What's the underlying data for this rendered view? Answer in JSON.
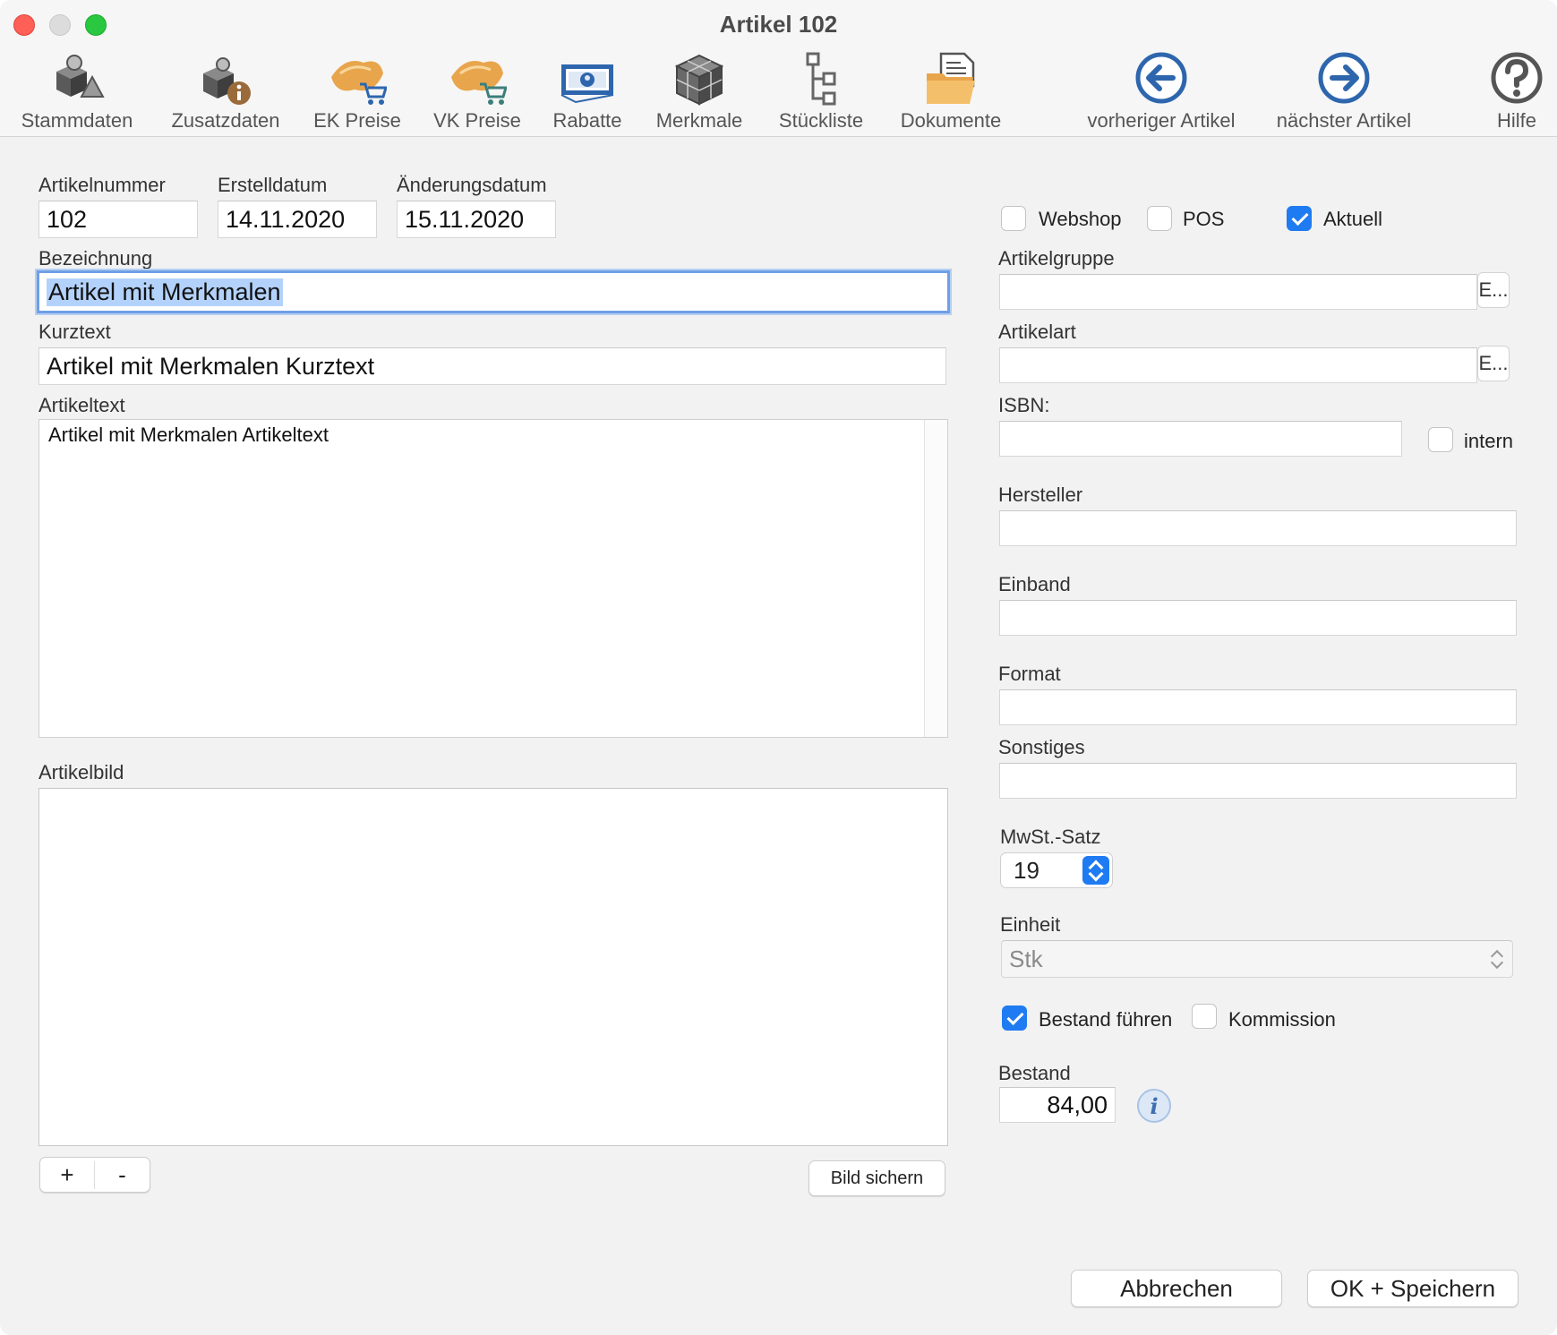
{
  "window": {
    "title": "Artikel 102"
  },
  "toolbar": {
    "stammdaten": "Stammdaten",
    "zusatzdaten": "Zusatzdaten",
    "ek_preise": "EK Preise",
    "vk_preise": "VK Preise",
    "rabatte": "Rabatte",
    "merkmale": "Merkmale",
    "stueckliste": "Stückliste",
    "dokumente": "Dokumente",
    "vorheriger": "vorheriger Artikel",
    "naechster": "nächster Artikel",
    "hilfe": "Hilfe"
  },
  "form": {
    "artikelnummer_label": "Artikelnummer",
    "artikelnummer": "102",
    "erstelldatum_label": "Erstelldatum",
    "erstelldatum": "14.11.2020",
    "aenderungsdatum_label": "Änderungsdatum",
    "aenderungsdatum": "15.11.2020",
    "bezeichnung_label": "Bezeichnung",
    "bezeichnung": "Artikel mit Merkmalen",
    "kurztext_label": "Kurztext",
    "kurztext": "Artikel mit Merkmalen Kurztext",
    "artikeltext_label": "Artikeltext",
    "artikeltext": "Artikel mit Merkmalen Artikeltext",
    "artikelbild_label": "Artikelbild",
    "add_label": "+",
    "remove_label": "-",
    "bild_sichern": "Bild sichern"
  },
  "right": {
    "webshop": "Webshop",
    "webshop_checked": false,
    "pos": "POS",
    "pos_checked": false,
    "aktuell": "Aktuell",
    "aktuell_checked": true,
    "artikelgruppe_label": "Artikelgruppe",
    "artikelgruppe": "",
    "artikelart_label": "Artikelart",
    "artikelart": "",
    "combo_btn": "E...",
    "isbn_label": "ISBN:",
    "isbn": "",
    "intern": "intern",
    "intern_checked": false,
    "hersteller_label": "Hersteller",
    "hersteller": "",
    "einband_label": "Einband",
    "einband": "",
    "format_label": "Format",
    "format": "",
    "sonstiges_label": "Sonstiges",
    "sonstiges": "",
    "mwst_label": "MwSt.-Satz",
    "mwst": "19",
    "einheit_label": "Einheit",
    "einheit": "Stk",
    "bestand_fuehren": "Bestand führen",
    "bestand_fuehren_checked": true,
    "kommission": "Kommission",
    "kommission_checked": false,
    "bestand_label": "Bestand",
    "bestand": "84,00"
  },
  "footer": {
    "abbrechen": "Abbrechen",
    "ok_speichern": "OK + Speichern"
  },
  "colors": {
    "accent": "#1f7bf2",
    "icon_orange": "#e8a54c",
    "icon_blue": "#2e66ad",
    "icon_gray": "#6a6a6a"
  }
}
